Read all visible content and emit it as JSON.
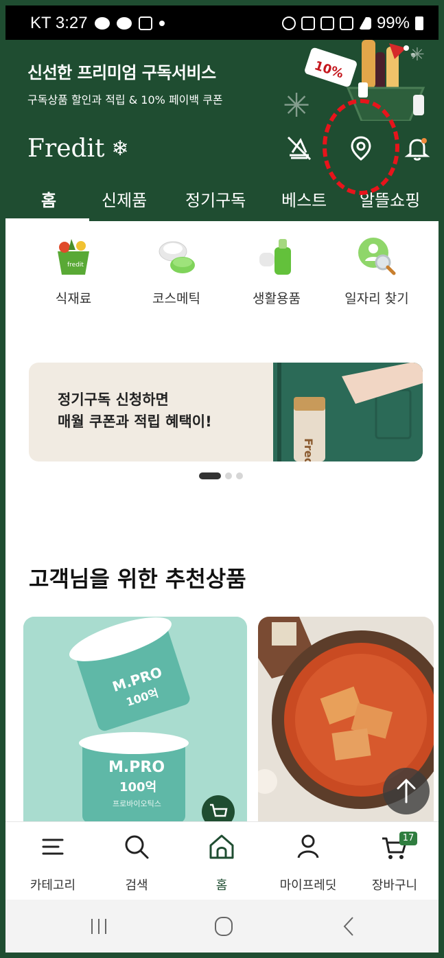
{
  "status_bar": {
    "carrier_time": "KT 3:27",
    "battery": "99%"
  },
  "promo": {
    "title": "신선한 프리미엄 구독서비스",
    "subtitle": "구독상품 할인과 적립 & 10% 페이백 쿠폰",
    "tag": "10%"
  },
  "header": {
    "logo": "Fredit",
    "logo_icon": "snowflake-icon"
  },
  "tabs": [
    {
      "label": "홈"
    },
    {
      "label": "신제품"
    },
    {
      "label": "정기구독"
    },
    {
      "label": "베스트"
    },
    {
      "label": "알뜰쇼핑"
    }
  ],
  "categories": [
    {
      "label": "식재료",
      "icon": "grocery-basket-icon"
    },
    {
      "label": "코스메틱",
      "icon": "cosmetic-jar-icon"
    },
    {
      "label": "생활용품",
      "icon": "household-bottle-icon"
    },
    {
      "label": "일자리 찾기",
      "icon": "job-search-icon"
    }
  ],
  "banner": {
    "line1": "정기구독 신청하면",
    "line2": "매월 쿠폰과 적립 혜택이!",
    "bag_text": "Fred"
  },
  "recommend": {
    "title": "고객님을 위한 추천상품",
    "product1_text1": "M.PRO",
    "product1_text2": "100억",
    "product1_text3": "프로바이오틱스"
  },
  "bottom_nav": [
    {
      "label": "카테고리",
      "icon": "menu-icon"
    },
    {
      "label": "검색",
      "icon": "search-icon"
    },
    {
      "label": "홈",
      "icon": "home-icon"
    },
    {
      "label": "마이프레딧",
      "icon": "person-icon"
    },
    {
      "label": "장바구니",
      "icon": "cart-icon"
    }
  ],
  "cart_count": "17",
  "colors": {
    "brand_green": "#1f4d31",
    "highlight_red": "#e8141b"
  }
}
